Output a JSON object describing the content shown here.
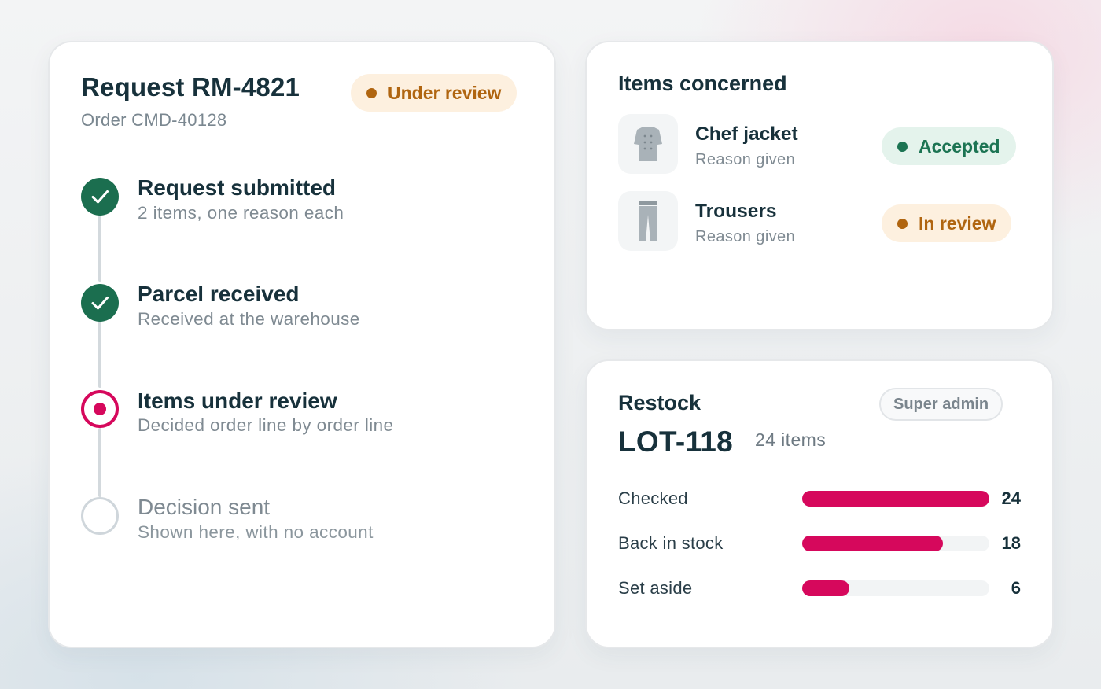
{
  "request": {
    "title": "Request RM-4821",
    "order": "Order CMD-40128",
    "status": "Under review",
    "timeline": [
      {
        "title": "Request submitted",
        "desc": "2 items, one reason each",
        "state": "done"
      },
      {
        "title": "Parcel received",
        "desc": "Received at the warehouse",
        "state": "done"
      },
      {
        "title": "Items under review",
        "desc": "Decided order line by order line",
        "state": "active"
      },
      {
        "title": "Decision sent",
        "desc": "Shown here, with no account",
        "state": "pending"
      }
    ]
  },
  "items": {
    "heading": "Items concerned",
    "list": [
      {
        "name": "Chef jacket",
        "reason": "Reason given",
        "status": "Accepted",
        "icon": "chef-jacket-icon"
      },
      {
        "name": "Trousers",
        "reason": "Reason given",
        "status": "In review",
        "icon": "trousers-icon"
      }
    ]
  },
  "restock": {
    "heading": "Restock",
    "role": "Super admin",
    "lot": "LOT-118",
    "count": "24 items",
    "stats": [
      {
        "label": "Checked",
        "value": "24",
        "fraction": 1.0
      },
      {
        "label": "Back in stock",
        "value": "18",
        "fraction": 0.75
      },
      {
        "label": "Set aside",
        "value": "6",
        "fraction": 0.25
      }
    ]
  },
  "colors": {
    "accent": "#d6085c",
    "done": "#1b6e4f",
    "pending_badge": "#b06510",
    "accepted_badge": "#1c7453"
  }
}
